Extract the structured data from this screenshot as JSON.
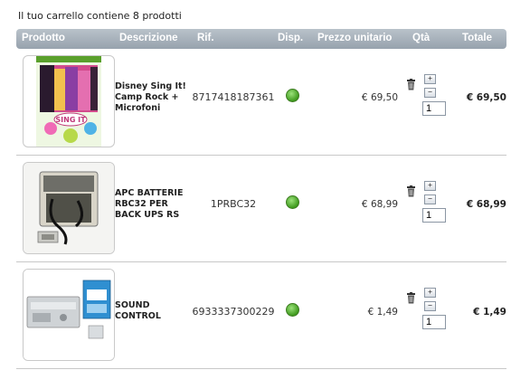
{
  "cart_summary": "Il tuo carrello contiene 8 prodotti",
  "columns": {
    "product": "Prodotto",
    "description": "Descrizione",
    "ref": "Rif.",
    "availability": "Disp.",
    "unit_price": "Prezzo unitario",
    "qty": "Qtà",
    "total": "Totale"
  },
  "items": [
    {
      "description": "Disney Sing It! Camp Rock + Microfoni",
      "ref": "8717418187361",
      "unit_price": "€ 69,50",
      "quantity": "1",
      "total": "€ 69,50",
      "availability_color": "#5bbf35"
    },
    {
      "description": "APC BATTERIE RBC32 PER BACK UPS RS",
      "ref": "1PRBC32",
      "unit_price": "€ 68,99",
      "quantity": "1",
      "total": "€ 68,99",
      "availability_color": "#5bbf35"
    },
    {
      "description": "SOUND CONTROL",
      "ref": "6933337300229",
      "unit_price": "€ 1,49",
      "quantity": "1",
      "total": "€ 1,49",
      "availability_color": "#5bbf35"
    }
  ],
  "icons": {
    "trash": "trash-icon",
    "increase": "plus-icon",
    "decrease": "minus-icon"
  },
  "colors": {
    "header_top": "#b9c2ca",
    "header_bottom": "#97a2ad"
  }
}
